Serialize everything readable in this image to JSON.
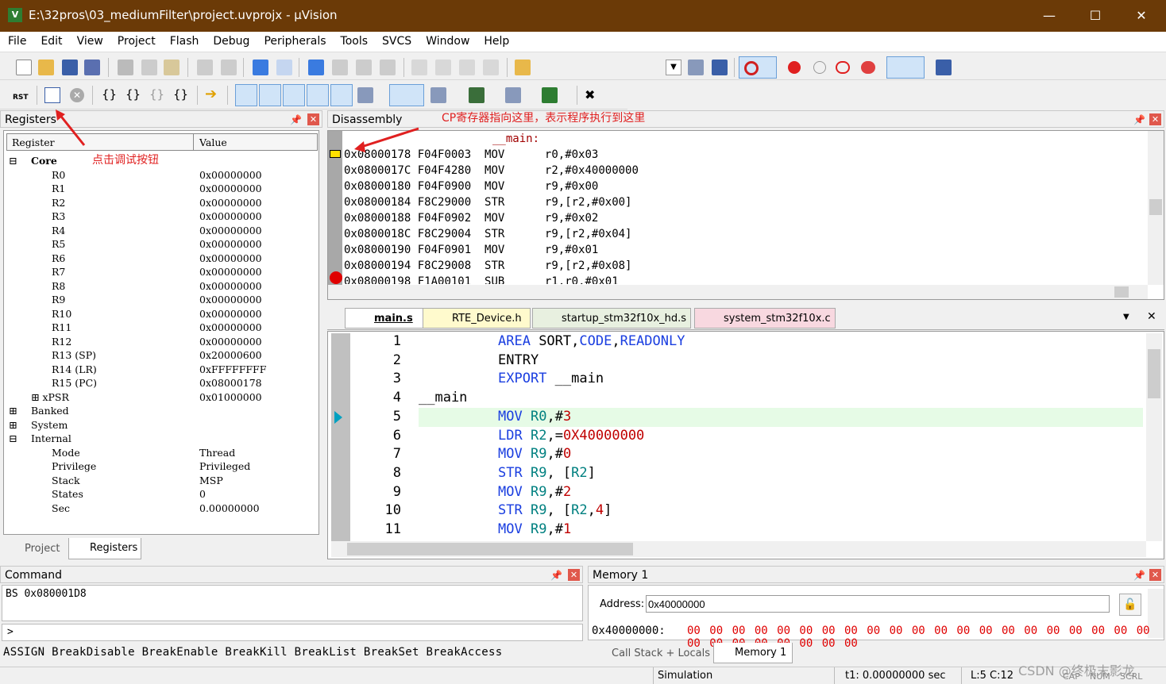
{
  "window": {
    "title": "E:\\32pros\\03_mediumFilter\\project.uvprojx - µVision",
    "app_icon": "uvision-icon"
  },
  "menu": [
    "File",
    "Edit",
    "View",
    "Project",
    "Flash",
    "Debug",
    "Peripherals",
    "Tools",
    "SVCS",
    "Window",
    "Help"
  ],
  "registers": {
    "title": "Registers",
    "col_register": "Register",
    "col_value": "Value",
    "core_label": "Core",
    "core": [
      {
        "name": "R0",
        "value": "0x00000000"
      },
      {
        "name": "R1",
        "value": "0x00000000"
      },
      {
        "name": "R2",
        "value": "0x00000000"
      },
      {
        "name": "R3",
        "value": "0x00000000"
      },
      {
        "name": "R4",
        "value": "0x00000000"
      },
      {
        "name": "R5",
        "value": "0x00000000"
      },
      {
        "name": "R6",
        "value": "0x00000000"
      },
      {
        "name": "R7",
        "value": "0x00000000"
      },
      {
        "name": "R8",
        "value": "0x00000000"
      },
      {
        "name": "R9",
        "value": "0x00000000"
      },
      {
        "name": "R10",
        "value": "0x00000000"
      },
      {
        "name": "R11",
        "value": "0x00000000"
      },
      {
        "name": "R12",
        "value": "0x00000000"
      },
      {
        "name": "R13 (SP)",
        "value": "0x20000600"
      },
      {
        "name": "R14 (LR)",
        "value": "0xFFFFFFFF"
      },
      {
        "name": "R15 (PC)",
        "value": "0x08000178"
      },
      {
        "name": "xPSR",
        "value": "0x01000000"
      }
    ],
    "banked_label": "Banked",
    "system_label": "System",
    "internal_label": "Internal",
    "internal": [
      {
        "name": "Mode",
        "value": "Thread"
      },
      {
        "name": "Privilege",
        "value": "Privileged"
      },
      {
        "name": "Stack",
        "value": "MSP"
      },
      {
        "name": "States",
        "value": "0"
      },
      {
        "name": "Sec",
        "value": "0.00000000"
      }
    ],
    "tab_project": "Project",
    "tab_registers": "Registers"
  },
  "disassembly": {
    "title": "Disassembly",
    "label": "__main:",
    "rows": [
      {
        "addr": "0x08000178",
        "code": "F04F0003",
        "op": "MOV",
        "args": "r0,#0x03"
      },
      {
        "addr": "0x0800017C",
        "code": "F04F4280",
        "op": "MOV",
        "args": "r2,#0x40000000"
      },
      {
        "addr": "0x08000180",
        "code": "F04F0900",
        "op": "MOV",
        "args": "r9,#0x00"
      },
      {
        "addr": "0x08000184",
        "code": "F8C29000",
        "op": "STR",
        "args": "r9,[r2,#0x00]"
      },
      {
        "addr": "0x08000188",
        "code": "F04F0902",
        "op": "MOV",
        "args": "r9,#0x02"
      },
      {
        "addr": "0x0800018C",
        "code": "F8C29004",
        "op": "STR",
        "args": "r9,[r2,#0x04]"
      },
      {
        "addr": "0x08000190",
        "code": "F04F0901",
        "op": "MOV",
        "args": "r9,#0x01"
      },
      {
        "addr": "0x08000194",
        "code": "F8C29008",
        "op": "STR",
        "args": "r9,[r2,#0x08]"
      },
      {
        "addr": "0x08000198",
        "code": "F1A00101",
        "op": "SUB",
        "args": "r1,r0,#0x01"
      }
    ]
  },
  "annotations": {
    "pc": "CP寄存器指向这里，表示程序执行到这里",
    "debug": "点击调试按钮"
  },
  "editor": {
    "tabs": [
      "main.s",
      "RTE_Device.h",
      "startup_stm32f10x_hd.s",
      "system_stm32f10x.c"
    ],
    "lines": [
      {
        "n": "1",
        "indent": "",
        "p": [
          [
            "kw",
            "AREA"
          ],
          [
            "t",
            " SORT,"
          ],
          [
            "kw",
            "CODE"
          ],
          [
            "t",
            ","
          ],
          [
            "kw",
            "READONLY"
          ]
        ]
      },
      {
        "n": "2",
        "indent": "",
        "p": [
          [
            "t",
            "ENTRY"
          ]
        ]
      },
      {
        "n": "3",
        "indent": "",
        "p": [
          [
            "kw",
            "EXPORT"
          ],
          [
            "t",
            " __main"
          ]
        ]
      },
      {
        "n": "4",
        "indent": "label",
        "p": [
          [
            "t",
            "__main"
          ]
        ]
      },
      {
        "n": "5",
        "indent": "",
        "p": [
          [
            "kw",
            "MOV"
          ],
          [
            "t",
            " "
          ],
          [
            "rg",
            "R0"
          ],
          [
            "t",
            ",#"
          ],
          [
            "nm",
            "3"
          ]
        ]
      },
      {
        "n": "6",
        "indent": "",
        "p": [
          [
            "kw",
            "LDR"
          ],
          [
            "t",
            " "
          ],
          [
            "rg",
            "R2"
          ],
          [
            "t",
            ",="
          ],
          [
            "nm",
            "0X40000000"
          ]
        ]
      },
      {
        "n": "7",
        "indent": "",
        "p": [
          [
            "kw",
            "MOV"
          ],
          [
            "t",
            " "
          ],
          [
            "rg",
            "R9"
          ],
          [
            "t",
            ",#"
          ],
          [
            "nm",
            "0"
          ]
        ]
      },
      {
        "n": "8",
        "indent": "",
        "p": [
          [
            "kw",
            "STR"
          ],
          [
            "t",
            " "
          ],
          [
            "rg",
            "R9"
          ],
          [
            "t",
            ", ["
          ],
          [
            "rg",
            "R2"
          ],
          [
            "t",
            "]"
          ]
        ]
      },
      {
        "n": "9",
        "indent": "",
        "p": [
          [
            "kw",
            "MOV"
          ],
          [
            "t",
            " "
          ],
          [
            "rg",
            "R9"
          ],
          [
            "t",
            ",#"
          ],
          [
            "nm",
            "2"
          ]
        ]
      },
      {
        "n": "10",
        "indent": "",
        "p": [
          [
            "kw",
            "STR"
          ],
          [
            "t",
            " "
          ],
          [
            "rg",
            "R9"
          ],
          [
            "t",
            ", ["
          ],
          [
            "rg",
            "R2"
          ],
          [
            "t",
            ","
          ],
          [
            "nm",
            "4"
          ],
          [
            "t",
            "]"
          ]
        ]
      },
      {
        "n": "11",
        "indent": "",
        "p": [
          [
            "kw",
            "MOV"
          ],
          [
            "t",
            " "
          ],
          [
            "rg",
            "R9"
          ],
          [
            "t",
            ",#"
          ],
          [
            "nm",
            "1"
          ]
        ]
      }
    ]
  },
  "command": {
    "title": "Command",
    "output": "BS 0x080001D8",
    "prompt": ">",
    "hint": "ASSIGN BreakDisable BreakEnable BreakKill BreakList BreakSet BreakAccess"
  },
  "memory": {
    "title": "Memory 1",
    "address_label": "Address:",
    "address_value": "0x40000000",
    "row_addr": "0x40000000:",
    "row_bytes": "00 00 00 00 00 00 00 00 00 00 00 00 00 00 00 00 00 00 00 00 00 00 00 00 00 00 00 00 00",
    "tab_callstack": "Call Stack + Locals",
    "tab_memory": "Memory 1"
  },
  "status": {
    "mode": "Simulation",
    "time": "t1: 0.00000000 sec",
    "position": "L:5 C:12",
    "caps": "CAP",
    "num": "NUM",
    "scrl": "SCRL",
    "watermark": "CSDN @终极末影龙"
  }
}
